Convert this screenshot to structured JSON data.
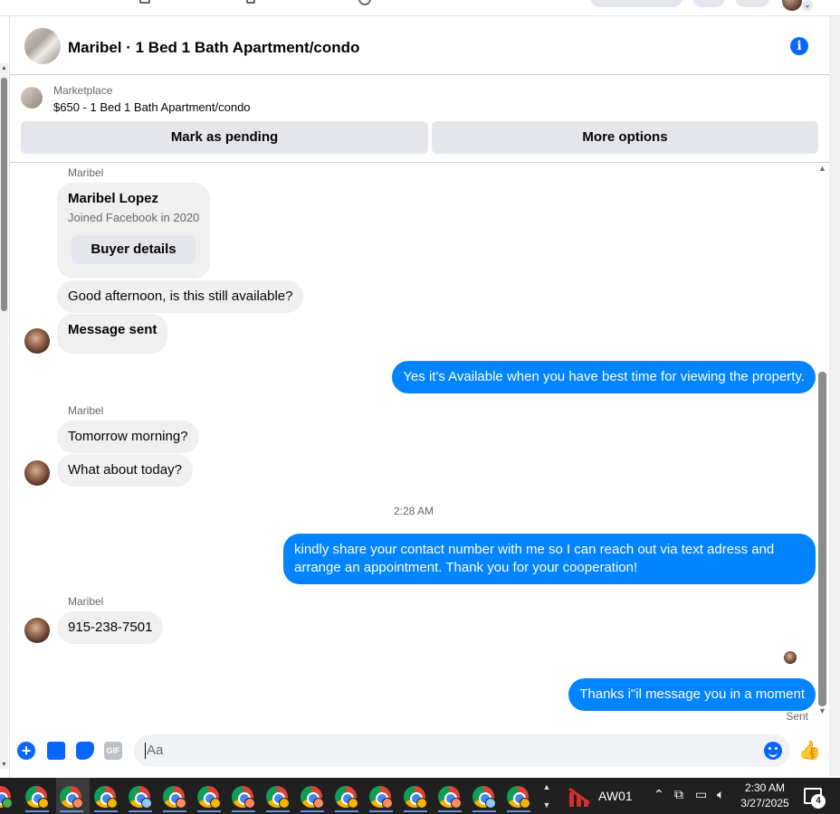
{
  "header": {
    "title": "Maribel · 1 Bed 1 Bath Apartment/condo",
    "info_icon": "i"
  },
  "listing": {
    "source": "Marketplace",
    "price_title": "$650 - 1 Bed 1 Bath Apartment/condo",
    "mark_pending_label": "Mark as pending",
    "more_options_label": "More options"
  },
  "thread": {
    "buyer_card": {
      "sender": "Maribel",
      "name": "Maribel Lopez",
      "joined": "Joined Facebook in 2020",
      "button_label": "Buyer details"
    },
    "messages": [
      {
        "direction": "in",
        "text": "Good afternoon, is this still available?"
      },
      {
        "direction": "in",
        "text": "Message sent",
        "bold": true
      },
      {
        "direction": "out",
        "text": "Yes it's Available when you have best time for viewing the property."
      },
      {
        "direction": "in",
        "sender": "Maribel",
        "text": "Tomorrow morning?"
      },
      {
        "direction": "in",
        "text": "What about today?"
      },
      {
        "direction": "time",
        "text": "2:28 AM"
      },
      {
        "direction": "out",
        "text_line1": "kindly share your contact number with me so I can reach out via text adress and",
        "text_line2": "arrange an appointment. Thank you for your cooperation!"
      },
      {
        "direction": "in",
        "sender": "Maribel",
        "text": "915-238-7501"
      },
      {
        "direction": "out",
        "text": "Thanks i\"il message you in a moment"
      }
    ],
    "sender_name": "Maribel",
    "status": "Sent"
  },
  "composer": {
    "placeholder": "Aa",
    "icons": [
      "plus-icon",
      "photo-icon",
      "sticker-icon",
      "gif-icon",
      "emoji-icon",
      "like-icon"
    ],
    "gif_label": "GIF",
    "like_glyph": "👍"
  },
  "taskbar": {
    "app_label": "AW01",
    "time": "2:30 AM",
    "date": "3/27/2025",
    "notification_count": "4",
    "tray_icons": [
      "chevron-up-icon",
      "network-adapter-icon",
      "network-icon",
      "volume-icon"
    ]
  }
}
